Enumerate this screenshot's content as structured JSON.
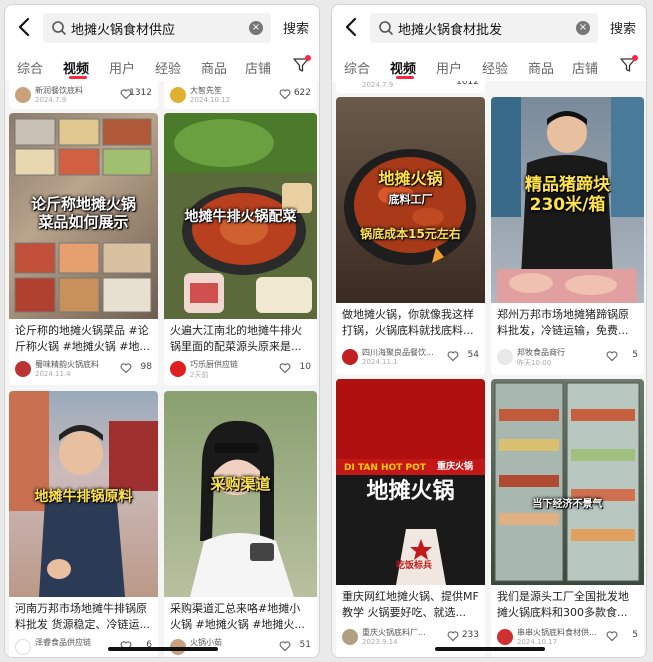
{
  "left": {
    "search_query": "地摊火锅食材供应",
    "search_button": "搜索",
    "tabs": [
      "综合",
      "视频",
      "用户",
      "经验",
      "商品",
      "店铺"
    ],
    "top_cards": [
      {
        "author": "新润餐饮底料",
        "date": "2024.7.9",
        "likes": "1312"
      },
      {
        "author": "大智先笙",
        "date": "2024.10.12",
        "likes": "622"
      }
    ],
    "cards": [
      {
        "overlay": "论斤称地摊火锅\n菜品如何展示",
        "title": "论斤称的地摊火锅菜品 #论斤称火锅 #地摊火锅 #地...",
        "author": "蜀味精韵火锅底料",
        "date": "2024.11.4",
        "likes": "98"
      },
      {
        "overlay": "地摊牛排火锅配菜",
        "title": "火遍大江南北的地摊牛排火锅里面的配菜源头原来是...",
        "author": "巧乐厨供应链",
        "date": "2天前",
        "likes": "10"
      },
      {
        "overlay": "地摊牛排锅原料",
        "title": "河南万邦市场地摊牛排锅原料批发 货源稳定、冷链运...",
        "author": "泽睿食品供应链",
        "date": "",
        "likes": "6"
      },
      {
        "overlay": "采购渠道",
        "title": "采购渠道汇总来咯#地摊小火锅 #地摊火锅 #地摊火...",
        "author": "火锅小茹",
        "date": "",
        "likes": "51"
      }
    ]
  },
  "right": {
    "search_query": "地摊火锅食材批发",
    "search_button": "搜索",
    "tabs": [
      "综合",
      "视频",
      "用户",
      "经验",
      "商品",
      "店铺"
    ],
    "top_cards": [
      {
        "author": "",
        "date": "2024.7.9",
        "likes": "1012"
      }
    ],
    "cards": [
      {
        "overlay_main": "地摊火锅",
        "overlay_sub": "底料工厂",
        "overlay_bottom": "锅底成本15元左右",
        "title": "做地摊火锅，你就像我这样打锅，火锅底料就找底料...",
        "author": "四川海聚良品餐饮...",
        "date": "2024.11.1",
        "likes": "54"
      },
      {
        "overlay": "精品猪蹄块\n230米/箱",
        "title": "郑州万邦市场地摊猪蹄锅原料批发，冷链运输，免费...",
        "author": "邦牧食品商行",
        "date": "昨天10:00",
        "likes": "5"
      },
      {
        "overlay_top": "DI TAN HOT POT",
        "overlay_badge": "重庆火锅",
        "overlay": "地摊火锅",
        "overlay_bottom": "吃饭标兵",
        "title": "重庆网红地摊火锅、提供MF教学 火锅要好吃、就选...",
        "author": "重庆火锅底料厂...",
        "date": "2023.9.14",
        "likes": "233"
      },
      {
        "overlay": "当下经济不景气",
        "title": "我们是源头工厂全国批发地摊火锅底料和300多款食...",
        "author": "串串火锅底料食材供...",
        "date": "2024.10.17",
        "likes": "5"
      }
    ]
  },
  "colors": {
    "accent": "#ff2442",
    "text": "#222222",
    "muted": "#999999"
  }
}
